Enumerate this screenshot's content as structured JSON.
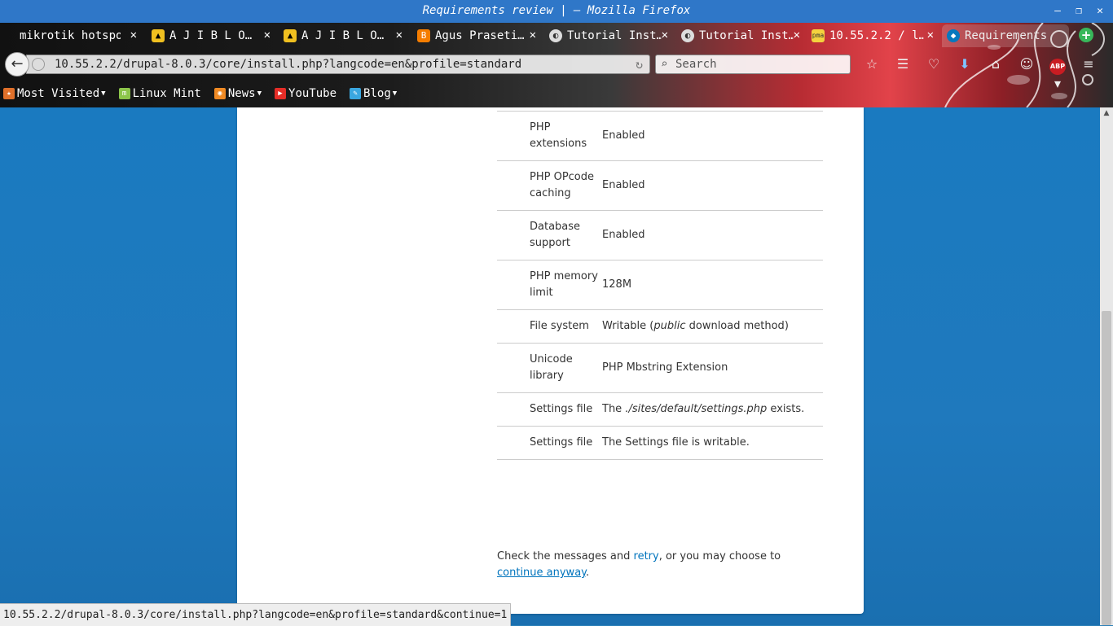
{
  "window": {
    "title": "Requirements review | — Mozilla Firefox"
  },
  "tabs": [
    {
      "label": "mikrotik hotspot…",
      "icon": "none"
    },
    {
      "label": "A J I B L O…",
      "icon": "tux-icon"
    },
    {
      "label": "A J I B L O…",
      "icon": "tux-icon"
    },
    {
      "label": "Agus Praseti…",
      "icon": "blogger-icon"
    },
    {
      "label": "Tutorial Inst…",
      "icon": "page-icon"
    },
    {
      "label": "Tutorial Inst…",
      "icon": "page-icon"
    },
    {
      "label": "10.55.2.2 / l…",
      "icon": "phpmyadmin-icon"
    },
    {
      "label": "Requirements",
      "icon": "drupal-icon"
    }
  ],
  "nav": {
    "url": "10.55.2.2/drupal-8.0.3/core/install.php?langcode=en&profile=standard",
    "search_placeholder": "Search"
  },
  "bookmarks": [
    {
      "label": "Most Visited",
      "dropdown": true,
      "icon": "most-visited-icon"
    },
    {
      "label": "Linux Mint",
      "dropdown": false,
      "icon": "linux-mint-icon"
    },
    {
      "label": "News",
      "dropdown": true,
      "icon": "rss-icon"
    },
    {
      "label": "YouTube",
      "dropdown": false,
      "icon": "youtube-icon"
    },
    {
      "label": "Blog",
      "dropdown": true,
      "icon": "blog-icon"
    }
  ],
  "requirements": [
    {
      "label": "PHP extensions",
      "value": "Enabled"
    },
    {
      "label": "PHP OPcode caching",
      "value": "Enabled"
    },
    {
      "label": "Database support",
      "value": "Enabled"
    },
    {
      "label": "PHP memory limit",
      "value": "128M"
    },
    {
      "label": "File system",
      "value_pre": "Writable (",
      "value_em": "public",
      "value_post": " download method)"
    },
    {
      "label": "Unicode library",
      "value": "PHP Mbstring Extension"
    },
    {
      "label": "Settings file",
      "value_pre": "The ",
      "value_em": "./sites/default/settings.php",
      "value_post": " exists."
    },
    {
      "label": "Settings file",
      "value": "The Settings file is writable."
    }
  ],
  "message": {
    "text_1": "Check the messages and ",
    "retry_link": "retry",
    "text_2": ", or you may choose to ",
    "continue_link": "continue anyway",
    "text_3": "."
  },
  "status_bar": {
    "text": "10.55.2.2/drupal-8.0.3/core/install.php?langcode=en&profile=standard&continue=1"
  },
  "colors": {
    "link": "#0074bd",
    "page_background": "#1f79bd",
    "titlebar": "#2f77c8"
  }
}
